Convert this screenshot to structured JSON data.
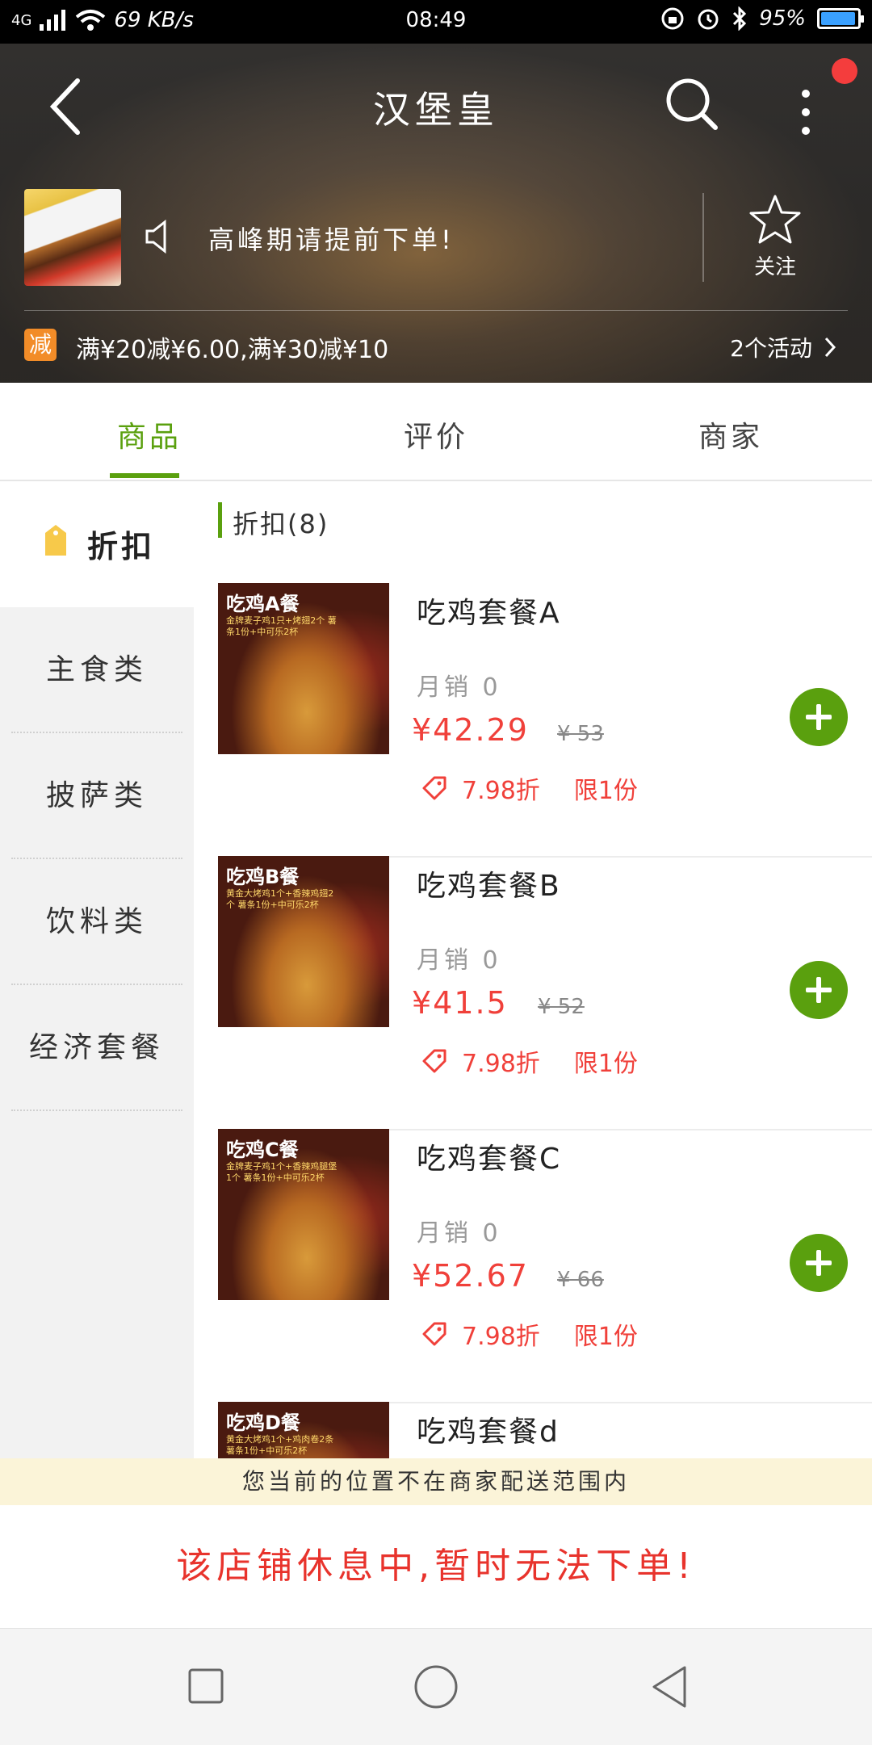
{
  "status_bar": {
    "network": "4G",
    "speed": "69 KB/s",
    "time": "08:49",
    "battery": "95%",
    "battery_level": 0.95
  },
  "header": {
    "title": "汉堡皇",
    "notice": "高峰期请提前下单!",
    "follow_label": "关注",
    "promo_badge": "减",
    "promo_text": "满¥20减¥6.00,满¥30减¥10",
    "activity_label": "2个活动"
  },
  "tabs": [
    {
      "label": "商品",
      "active": true
    },
    {
      "label": "评价",
      "active": false
    },
    {
      "label": "商家",
      "active": false
    }
  ],
  "categories": [
    {
      "label": "折扣",
      "active": true
    },
    {
      "label": "主食类"
    },
    {
      "label": "披萨类"
    },
    {
      "label": "饮料类"
    },
    {
      "label": "经济套餐"
    }
  ],
  "section": {
    "title": "折扣(8)"
  },
  "items": [
    {
      "name": "吃鸡套餐A",
      "image_title": "吃鸡A餐",
      "image_sub": "金牌麦子鸡1只+烤翅2个 薯条1份+中可乐2杯",
      "sales": "月销 0",
      "price": "¥42.29",
      "old_price": "¥ 53",
      "discount": "7.98折",
      "limit": "限1份"
    },
    {
      "name": "吃鸡套餐B",
      "image_title": "吃鸡B餐",
      "image_sub": "黄金大烤鸡1个+香辣鸡翅2个 薯条1份+中可乐2杯",
      "sales": "月销 0",
      "price": "¥41.5",
      "old_price": "¥ 52",
      "discount": "7.98折",
      "limit": "限1份"
    },
    {
      "name": "吃鸡套餐C",
      "image_title": "吃鸡C餐",
      "image_sub": "金牌麦子鸡1个+香辣鸡腿堡1个 薯条1份+中可乐2杯",
      "sales": "月销 0",
      "price": "¥52.67",
      "old_price": "¥ 66",
      "discount": "7.98折",
      "limit": "限1份"
    },
    {
      "name": "吃鸡套餐d",
      "image_title": "吃鸡D餐",
      "image_sub": "黄金大烤鸡1个+鸡肉卷2条 薯条1份+中可乐2杯"
    }
  ],
  "banners": {
    "out_of_range": "您当前的位置不在商家配送范围内",
    "closed": "该店铺休息中,暂时无法下单!"
  },
  "colors": {
    "accent": "#5aa00e",
    "price": "#f0403a",
    "promo_badge": "#f28c28",
    "notification_dot": "#f43d3d"
  },
  "icons": [
    "back-arrow-icon",
    "search-icon",
    "more-vert-icon",
    "speaker-icon",
    "star-icon",
    "chevron-right-icon",
    "tag-icon",
    "price-tag-icon",
    "add-icon",
    "nav-recent-icon",
    "nav-home-icon",
    "nav-back-icon"
  ]
}
